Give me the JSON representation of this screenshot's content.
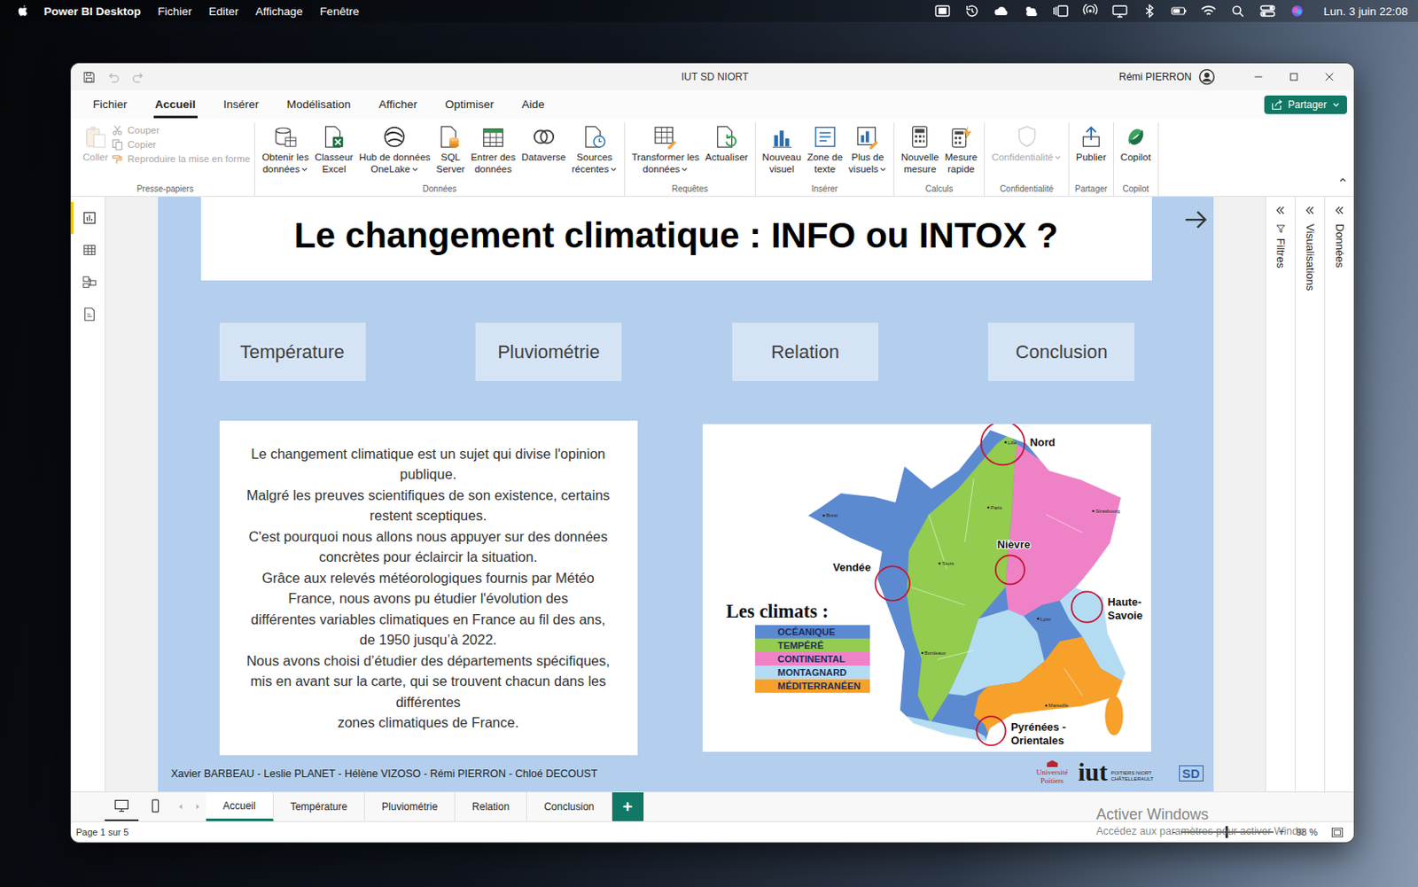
{
  "menubar": {
    "app": "Power BI Desktop",
    "menus": [
      "Fichier",
      "Editer",
      "Affichage",
      "Fenêtre"
    ],
    "clock": "Lun. 3 juin 22:08"
  },
  "window": {
    "title": "IUT SD NIORT",
    "user": "Rémi PIERRON"
  },
  "ribbon_tabs": [
    {
      "label": "Fichier",
      "selected": false
    },
    {
      "label": "Accueil",
      "selected": true
    },
    {
      "label": "Insérer",
      "selected": false
    },
    {
      "label": "Modélisation",
      "selected": false
    },
    {
      "label": "Afficher",
      "selected": false
    },
    {
      "label": "Optimiser",
      "selected": false
    },
    {
      "label": "Aide",
      "selected": false
    }
  ],
  "share_button": {
    "label": "Partager"
  },
  "ribbon_groups": [
    {
      "name": "Presse-papiers",
      "buttons": [
        {
          "lines": [
            "Coller"
          ],
          "dropdown": false,
          "disabled": true
        }
      ],
      "small": [
        {
          "label": "Couper",
          "disabled": true
        },
        {
          "label": "Copier",
          "disabled": true
        },
        {
          "label": "Reproduire la mise en forme",
          "disabled": true
        }
      ]
    },
    {
      "name": "Données",
      "buttons": [
        {
          "lines": [
            "Obtenir les",
            "données"
          ],
          "dropdown": true,
          "disabled": false
        },
        {
          "lines": [
            "Classeur",
            "Excel"
          ],
          "dropdown": false,
          "disabled": false
        },
        {
          "lines": [
            "Hub de données",
            "OneLake"
          ],
          "dropdown": true,
          "disabled": false
        },
        {
          "lines": [
            "SQL",
            "Server"
          ],
          "dropdown": false,
          "disabled": false
        },
        {
          "lines": [
            "Entrer des",
            "données"
          ],
          "dropdown": false,
          "disabled": false
        },
        {
          "lines": [
            "Dataverse"
          ],
          "dropdown": false,
          "disabled": false
        },
        {
          "lines": [
            "Sources",
            "récentes"
          ],
          "dropdown": true,
          "disabled": false
        }
      ],
      "small": []
    },
    {
      "name": "Requêtes",
      "buttons": [
        {
          "lines": [
            "Transformer les",
            "données"
          ],
          "dropdown": true,
          "disabled": false
        },
        {
          "lines": [
            "Actualiser"
          ],
          "dropdown": false,
          "disabled": false
        }
      ],
      "small": []
    },
    {
      "name": "Insérer",
      "buttons": [
        {
          "lines": [
            "Nouveau",
            "visuel"
          ],
          "dropdown": false,
          "disabled": false
        },
        {
          "lines": [
            "Zone de",
            "texte"
          ],
          "dropdown": false,
          "disabled": false
        },
        {
          "lines": [
            "Plus de",
            "visuels"
          ],
          "dropdown": true,
          "disabled": false
        }
      ],
      "small": []
    },
    {
      "name": "Calculs",
      "buttons": [
        {
          "lines": [
            "Nouvelle",
            "mesure"
          ],
          "dropdown": false,
          "disabled": false
        },
        {
          "lines": [
            "Mesure",
            "rapide"
          ],
          "dropdown": false,
          "disabled": false
        }
      ],
      "small": []
    },
    {
      "name": "Confidentialité",
      "buttons": [
        {
          "lines": [
            "Confidentialité"
          ],
          "dropdown": true,
          "disabled": true
        }
      ],
      "small": []
    },
    {
      "name": "Partager",
      "buttons": [
        {
          "lines": [
            "Publier"
          ],
          "dropdown": false,
          "disabled": false
        }
      ],
      "small": []
    },
    {
      "name": "Copilot",
      "buttons": [
        {
          "lines": [
            "Copilot"
          ],
          "dropdown": false,
          "disabled": false
        }
      ],
      "small": []
    }
  ],
  "left_nav": [
    {
      "selected": true
    },
    {
      "selected": false
    },
    {
      "selected": false
    },
    {
      "selected": false
    }
  ],
  "report": {
    "title": "Le changement climatique : INFO ou INTOX ?",
    "nav_buttons": [
      "Température",
      "Pluviométrie",
      "Relation",
      "Conclusion"
    ],
    "intro_lines": [
      "Le changement climatique est un sujet qui divise l'opinion",
      "publique.",
      "Malgré les preuves scientifiques de son existence, certains",
      "restent sceptiques.",
      "C'est pourquoi nous allons nous appuyer sur des données",
      "concrètes pour éclaircir la situation.",
      "Grâce aux relevés météorologiques fournis par Météo",
      "France, nous avons pu étudier l'évolution des",
      "différentes variables climatiques en France au fil des ans,",
      "de 1950 jusqu’à 2022.",
      "Nous avons choisi d’étudier des départements spécifiques,",
      "mis en avant sur la carte, qui se trouvent chacun dans les",
      "différentes",
      "zones climatiques de France."
    ],
    "map": {
      "legend_title": "Les climats :",
      "climates": [
        {
          "label": "OCÉANIQUE",
          "color": "#5b8ad1"
        },
        {
          "label": "TEMPÉRÉ",
          "color": "#93cc4e"
        },
        {
          "label": "CONTINENTAL",
          "color": "#ef82c7"
        },
        {
          "label": "MONTAGNARD",
          "color": "#b3dcf3"
        },
        {
          "label": "MÉDITERRANÉEN",
          "color": "#f7a12b"
        }
      ],
      "departments": [
        {
          "lines": [
            "Nord"
          ]
        },
        {
          "lines": [
            "Nièvre"
          ]
        },
        {
          "lines": [
            "Vendée"
          ]
        },
        {
          "lines": [
            "Haute-",
            "Savoie"
          ]
        },
        {
          "lines": [
            "Pyrénées -",
            "Orientales"
          ]
        }
      ],
      "cities": [
        "Lille",
        "Paris",
        "Brest",
        "Strasbourg",
        "Tours",
        "Lyon",
        "Bordeaux",
        "Marseille"
      ]
    },
    "authors": "Xavier BARBEAU - Leslie PLANET - Hélène VIZOSO - Rémi PIERRON - Chloé DECOUST",
    "logos": {
      "university": [
        "Université",
        "Poitiers"
      ],
      "iut": "iut",
      "iut_places": [
        "POITIERS NIORT",
        "CHÂTELLERAULT"
      ],
      "sd": "SD"
    }
  },
  "side_panes": [
    {
      "label": "Filtres"
    },
    {
      "label": "Visualisations"
    },
    {
      "label": "Données"
    }
  ],
  "page_tabs": {
    "views": [
      {
        "selected": true
      },
      {
        "selected": false
      }
    ],
    "tabs": [
      {
        "label": "Accueil",
        "selected": true
      },
      {
        "label": "Température",
        "selected": false
      },
      {
        "label": "Pluviométrie",
        "selected": false
      },
      {
        "label": "Relation",
        "selected": false
      },
      {
        "label": "Conclusion",
        "selected": false
      }
    ],
    "add": "+"
  },
  "status_bar": {
    "page": "Page 1 sur 5",
    "zoom": {
      "minus": "-",
      "plus": "+",
      "level": 0.49,
      "reading": "98 %"
    }
  },
  "watermark": {
    "title": "Activer Windows",
    "text": "Accédez aux paramètres pour activer Windo"
  }
}
